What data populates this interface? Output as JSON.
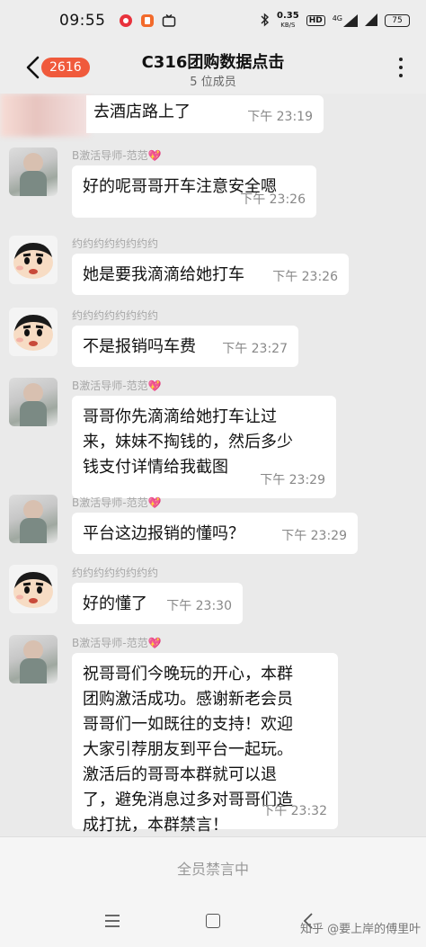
{
  "status_bar": {
    "time": "09:55",
    "network_speed": "0.35",
    "network_unit": "KB/S",
    "hd": "HD",
    "signal_label": "4G",
    "battery": "75"
  },
  "header": {
    "unread_count": "2616",
    "title": "C316团购数据点击",
    "subtitle": "5 位成员"
  },
  "messages": [
    {
      "sender": "",
      "text": "去酒店路上了",
      "time": "下午 23:19"
    },
    {
      "sender": "B激活导师-范范💖",
      "text": "好的呢哥哥开车注意安全嗯",
      "time": "下午 23:26"
    },
    {
      "sender": "约约约约约约约约",
      "text": "她是要我滴滴给她打车",
      "time": "下午 23:26"
    },
    {
      "sender": "约约约约约约约约",
      "text": "不是报销吗车费",
      "time": "下午 23:27"
    },
    {
      "sender": "B激活导师-范范💖",
      "text": "哥哥你先滴滴给她打车让过\n来，妹妹不掏钱的，然后多少\n钱支付详情给我截图",
      "time": "下午 23:29"
    },
    {
      "sender": "B激活导师-范范💖",
      "text": "平台这边报销的懂吗？",
      "time": "下午 23:29"
    },
    {
      "sender": "约约约约约约约约",
      "text": "好的懂了",
      "time": "下午 23:30"
    },
    {
      "sender": "B激活导师-范范💖",
      "text": "祝哥哥们今晚玩的开心，本群\n团购激活成功。感谢新老会员\n哥哥们一如既往的支持！欢迎\n大家引荐朋友到平台一起玩。\n激活后的哥哥本群就可以退\n了，避免消息过多对哥哥们造\n成打扰，本群禁言！",
      "time": "下午 23:32"
    }
  ],
  "footer": {
    "mute_label": "全员禁言中"
  },
  "watermark": "知乎 @要上岸的傅里叶",
  "colors": {
    "badge": "#f05a3c",
    "background": "#eaeaea",
    "bubble": "#ffffff"
  }
}
